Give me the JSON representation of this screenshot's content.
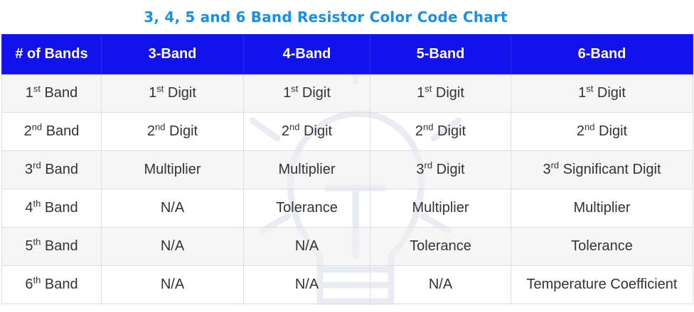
{
  "title": "3, 4, 5 and 6 Band Resistor Color Code Chart",
  "header": {
    "bands": "# of Bands",
    "b3": "3-Band",
    "b4": "4-Band",
    "b5": "5-Band",
    "b6": "6-Band"
  },
  "rows": [
    {
      "label": [
        "1",
        "st",
        " Band"
      ],
      "c3": [
        "1",
        "st",
        " Digit"
      ],
      "c4": [
        "1",
        "st",
        " Digit"
      ],
      "c5": [
        "1",
        "st",
        "  Digit"
      ],
      "c6": [
        "1",
        "st",
        "  Digit"
      ]
    },
    {
      "label": [
        "2",
        "nd",
        " Band"
      ],
      "c3": [
        "2",
        "nd",
        " Digit"
      ],
      "c4": [
        "2",
        "nd",
        " Digit"
      ],
      "c5": [
        "2",
        "nd",
        " Digit"
      ],
      "c6": [
        "2",
        "nd",
        "  Digit"
      ]
    },
    {
      "label": [
        "3",
        "rd",
        " Band"
      ],
      "c3": "Multiplier",
      "c4": "Multiplier",
      "c5": [
        "3",
        "rd",
        " Digit"
      ],
      "c6": [
        "3",
        "rd",
        " Significant Digit"
      ]
    },
    {
      "label": [
        "4",
        "th",
        " Band"
      ],
      "c3": "N/A",
      "c4": "Tolerance",
      "c5": "Multiplier",
      "c6": "Multiplier"
    },
    {
      "label": [
        "5",
        "th",
        " Band"
      ],
      "c3": "N/A",
      "c4": "N/A",
      "c5": "Tolerance",
      "c6": "Tolerance"
    },
    {
      "label": [
        "6",
        "th",
        " Band"
      ],
      "c3": "N/A",
      "c4": "N/A",
      "c5": "N/A",
      "c6": "Temperature Coefficient"
    }
  ],
  "colors": {
    "title": "#1a8fe8",
    "header_bg": "#1212ee",
    "watermark": "#c9cde4"
  },
  "icons": {
    "watermark": "lightbulb-icon"
  }
}
